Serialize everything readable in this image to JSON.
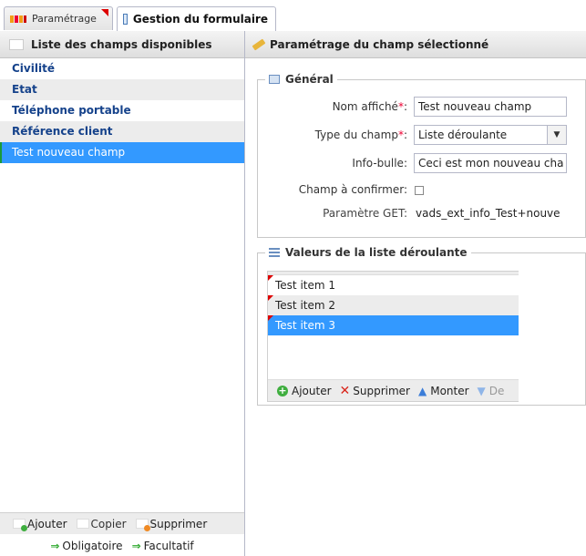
{
  "tabs": [
    {
      "label": "Paramétrage",
      "icon": "grid-icon"
    },
    {
      "label": "Gestion du formulaire",
      "icon": "form-icon"
    }
  ],
  "left_panel": {
    "title": "Liste des champs disponibles",
    "fields": [
      "Civilité",
      "Etat",
      "Téléphone portable",
      "Référence client",
      "Test nouveau champ"
    ],
    "selected_index": 4,
    "toolbar": {
      "add": "Ajouter",
      "copy": "Copier",
      "delete": "Supprimer"
    },
    "footer": {
      "mandatory": "Obligatoire",
      "optional": "Facultatif"
    }
  },
  "right_panel": {
    "title": "Paramétrage du champ sélectionné",
    "general": {
      "legend": "Général",
      "display_name_label": "Nom affiché",
      "display_name_value": "Test nouveau champ",
      "type_label": "Type du champ",
      "type_value": "Liste déroulante",
      "tooltip_label": "Info-bulle",
      "tooltip_value": "Ceci est mon nouveau cha",
      "confirm_label": "Champ à confirmer",
      "get_label": "Paramètre GET",
      "get_value": "vads_ext_info_Test+nouve",
      "required_mark": "*",
      "colon": ":"
    },
    "list_values": {
      "legend": "Valeurs de la liste déroulante",
      "items": [
        "Test item 1",
        "Test item 2",
        "Test item 3"
      ],
      "selected_index": 2,
      "toolbar": {
        "add": "Ajouter",
        "delete": "Supprimer",
        "up": "Monter",
        "down": "De"
      }
    }
  },
  "colors": {
    "accent": "#3399ff",
    "required": "#ee0033",
    "header_text": "#15428b"
  }
}
